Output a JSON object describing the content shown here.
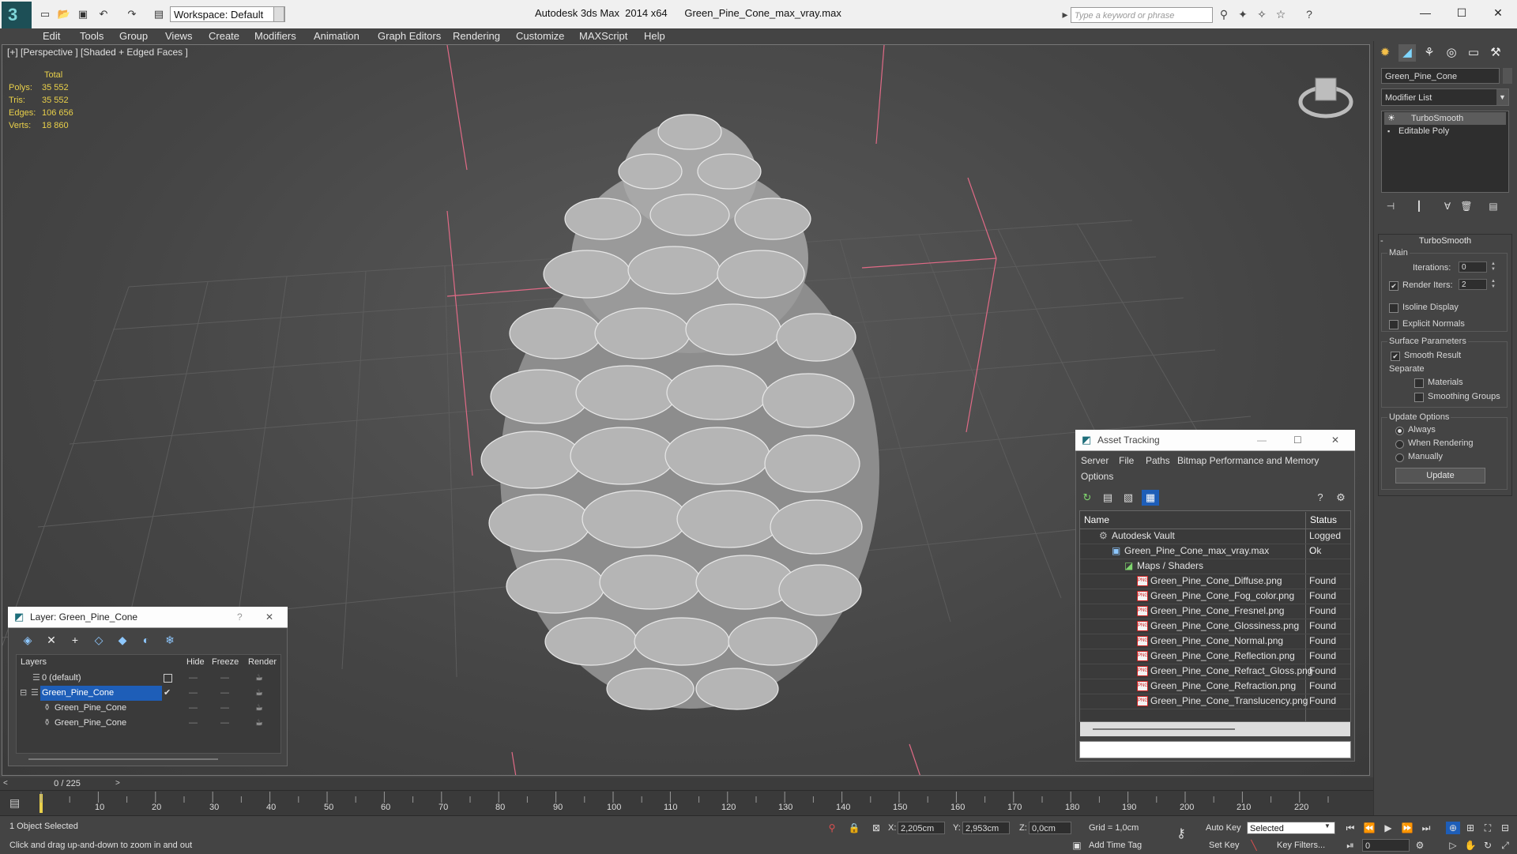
{
  "titlebar": {
    "workspace": "Workspace: Default",
    "app_name": "Autodesk 3ds Max  2014 x64",
    "file_name": "Green_Pine_Cone_max_vray.max",
    "search_placeholder": "Type a keyword or phrase"
  },
  "menus": [
    "Edit",
    "Tools",
    "Group",
    "Views",
    "Create",
    "Modifiers",
    "Animation",
    "Graph Editors",
    "Rendering",
    "Customize",
    "MAXScript",
    "Help"
  ],
  "viewport": {
    "label": "[+] [Perspective ] [Shaded + Edged Faces ]",
    "stats_header": "Total",
    "stats": [
      {
        "key": "Polys:",
        "value": "35 552"
      },
      {
        "key": "Tris:",
        "value": "35 552"
      },
      {
        "key": "Edges:",
        "value": "106 656"
      },
      {
        "key": "Verts:",
        "value": "18 860"
      }
    ]
  },
  "command_panel": {
    "object_name": "Green_Pine_Cone",
    "modifier_list": "Modifier List",
    "stack": [
      "TurboSmooth",
      "Editable Poly"
    ],
    "rollout_title": "TurboSmooth",
    "main_label": "Main",
    "iterations_label": "Iterations:",
    "iterations_value": "0",
    "render_iters_label": "Render Iters:",
    "render_iters_value": "2",
    "isoline_label": "Isoline Display",
    "explicit_normals_label": "Explicit Normals",
    "surface_params_label": "Surface Parameters",
    "smooth_result_label": "Smooth Result",
    "separate_label": "Separate",
    "materials_label": "Materials",
    "smoothing_groups_label": "Smoothing Groups",
    "update_options_label": "Update Options",
    "always_label": "Always",
    "when_rendering_label": "When Rendering",
    "manually_label": "Manually",
    "update_button": "Update"
  },
  "layer_window": {
    "title": "Layer: Green_Pine_Cone",
    "help": "?",
    "columns": {
      "layers": "Layers",
      "hide": "Hide",
      "freeze": "Freeze",
      "render": "Render"
    },
    "rows": [
      {
        "name": "0 (default)"
      },
      {
        "name": "Green_Pine_Cone"
      },
      {
        "name": "Green_Pine_Cone"
      },
      {
        "name": "Green_Pine_Cone"
      }
    ]
  },
  "asset_tracking": {
    "title": "Asset Tracking",
    "menu_row1": [
      "Server",
      "File",
      "Paths",
      "Bitmap Performance and Memory"
    ],
    "menu_row2": [
      "Options"
    ],
    "columns": {
      "name": "Name",
      "status": "Status"
    },
    "rows": [
      {
        "name": "Autodesk Vault",
        "status": "Logged O"
      },
      {
        "name": "Green_Pine_Cone_max_vray.max",
        "status": "Ok"
      },
      {
        "name": "Maps / Shaders",
        "status": ""
      },
      {
        "name": "Green_Pine_Cone_Diffuse.png",
        "status": "Found"
      },
      {
        "name": "Green_Pine_Cone_Fog_color.png",
        "status": "Found"
      },
      {
        "name": "Green_Pine_Cone_Fresnel.png",
        "status": "Found"
      },
      {
        "name": "Green_Pine_Cone_Glossiness.png",
        "status": "Found"
      },
      {
        "name": "Green_Pine_Cone_Normal.png",
        "status": "Found"
      },
      {
        "name": "Green_Pine_Cone_Reflection.png",
        "status": "Found"
      },
      {
        "name": "Green_Pine_Cone_Refract_Gloss.png",
        "status": "Found"
      },
      {
        "name": "Green_Pine_Cone_Refraction.png",
        "status": "Found"
      },
      {
        "name": "Green_Pine_Cone_Translucency.png",
        "status": "Found"
      }
    ]
  },
  "timeline": {
    "slider": "0 / 225",
    "ticks": [
      "10",
      "20",
      "30",
      "40",
      "50",
      "60",
      "70",
      "80",
      "90",
      "100",
      "110",
      "120",
      "130",
      "140",
      "150",
      "160",
      "170",
      "180",
      "190",
      "200",
      "210",
      "220"
    ]
  },
  "statusbar": {
    "selection": "1 Object Selected",
    "prompt": "Click and drag up-and-down to zoom in and out",
    "x_label": "X:",
    "x_value": "2,205cm",
    "y_label": "Y:",
    "y_value": "2,953cm",
    "z_label": "Z:",
    "z_value": "0,0cm",
    "grid": "Grid = 1,0cm",
    "add_time_tag": "Add Time Tag",
    "auto_key": "Auto Key",
    "set_key": "Set Key",
    "selected_dropdown": "Selected",
    "key_filters": "Key Filters...",
    "frame_value": "0"
  },
  "colors": {
    "stats": "#e9d04a",
    "selection": "#1e5eb8",
    "accent": "#1d4f56"
  }
}
